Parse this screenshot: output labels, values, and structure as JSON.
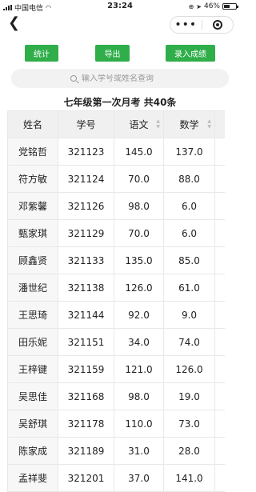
{
  "status_bar": {
    "carrier": "中国电信",
    "time": "23:24",
    "battery": "46%"
  },
  "nav": {
    "back_icon": "chevron-left-icon",
    "more_icon": "more-dots-icon",
    "close_icon": "target-close-icon"
  },
  "actions": {
    "stats": "统计",
    "export": "导出",
    "enter": "录入成绩",
    "color": "#2fae4a"
  },
  "search": {
    "placeholder": "输入学号或姓名查询"
  },
  "title": "七年级第一次月考 共40条",
  "table": {
    "headers": [
      "姓名",
      "学号",
      "语文",
      "数学"
    ],
    "rows": [
      {
        "name": "党铭哲",
        "id": "321123",
        "chinese": "145.0",
        "math": "137.0"
      },
      {
        "name": "符方敏",
        "id": "321124",
        "chinese": "70.0",
        "math": "88.0"
      },
      {
        "name": "邓紫馨",
        "id": "321126",
        "chinese": "98.0",
        "math": "6.0"
      },
      {
        "name": "甄家琪",
        "id": "321129",
        "chinese": "70.0",
        "math": "6.0"
      },
      {
        "name": "顾鑫贤",
        "id": "321133",
        "chinese": "135.0",
        "math": "85.0"
      },
      {
        "name": "潘世纪",
        "id": "321138",
        "chinese": "126.0",
        "math": "61.0"
      },
      {
        "name": "王思琦",
        "id": "321144",
        "chinese": "92.0",
        "math": "9.0"
      },
      {
        "name": "田乐妮",
        "id": "321151",
        "chinese": "34.0",
        "math": "74.0"
      },
      {
        "name": "王梓键",
        "id": "321159",
        "chinese": "121.0",
        "math": "126.0"
      },
      {
        "name": "吴思佳",
        "id": "321168",
        "chinese": "98.0",
        "math": "19.0"
      },
      {
        "name": "吴舒琪",
        "id": "321178",
        "chinese": "110.0",
        "math": "73.0"
      },
      {
        "name": "陈家成",
        "id": "321189",
        "chinese": "31.0",
        "math": "28.0"
      },
      {
        "name": "孟祥斐",
        "id": "321201",
        "chinese": "37.0",
        "math": "141.0"
      }
    ]
  }
}
